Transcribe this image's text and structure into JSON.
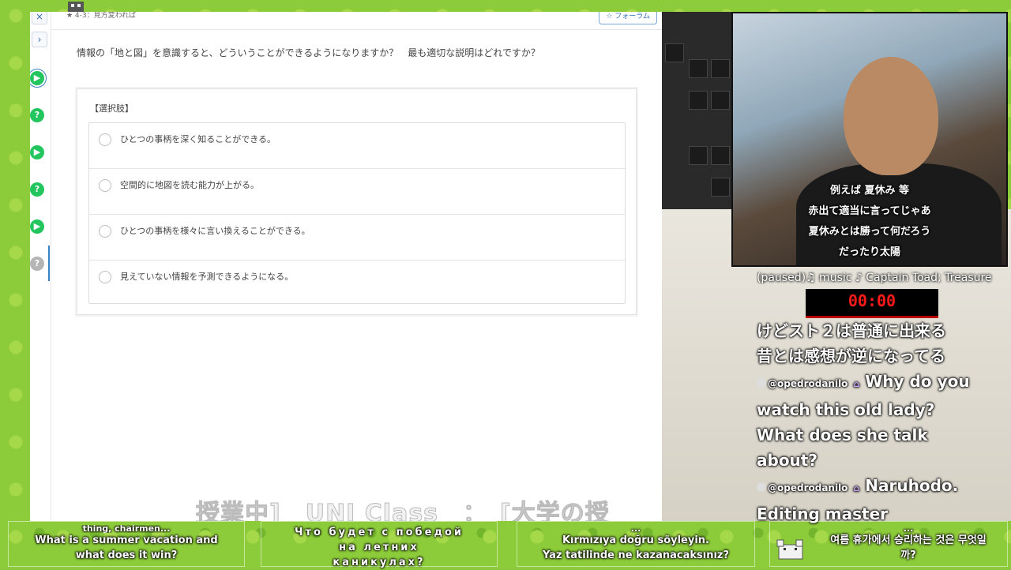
{
  "quiz": {
    "breadcrumb": "★ 4-3：見方変われば",
    "forum_label": "フォーラム",
    "question": "情報の「地と図」を意識すると、どういうことができるようになりますか？　最も適切な説明はどれですか？",
    "choices_heading": "【選択肢】",
    "choices": [
      "ひとつの事柄を深く知ることができる。",
      "空間的に地図を読む能力が上がる。",
      "ひとつの事柄を様々に言い換えることができる。",
      "見えていない情報を予測できるようになる。"
    ],
    "sidebar": {
      "close_icon": "×",
      "expand_icon": "›",
      "dot_play": "▶",
      "dot_question": "?"
    }
  },
  "banner_caption": "授業中]　UNI Class　：　[大学の授",
  "webcam": {
    "subtitles": [
      "例えば 夏休み 等",
      "赤出て適当に言ってじゃあ",
      "夏休みとは勝って何だろう",
      "だったり太陽"
    ]
  },
  "music_line": "(paused)♫ music ♪ Captain Toad; Treasure",
  "timer": "00:00",
  "chat": {
    "lines_top": [
      "けどスト２は普通に出来る",
      "昔とは感想が逆になってる"
    ],
    "messages": [
      {
        "user": "@opedrodanilo",
        "text_lines": [
          "Why do you",
          "watch this old lady?",
          "What does she talk",
          "about?"
        ]
      },
      {
        "user": "@opedrodanilo",
        "text_lines": [
          "Naruhodo.",
          "Editing master"
        ]
      }
    ],
    "badge_icon": "⌂"
  },
  "bottom_subtitles": {
    "en": [
      "thing, chairmen...",
      "What is a summer vacation and",
      "what does it win?"
    ],
    "ru": [
      "Что будет с победой",
      "на летних",
      "каникулах?"
    ],
    "tr": [
      "...",
      "Kırmızıya doğru söyleyin.",
      "Yaz tatilinde ne kazanacaksınız?"
    ],
    "ko": [
      "...",
      "여름 휴가에서 승리하는 것은 무엇일",
      "까?"
    ]
  },
  "colors": {
    "accent": "#3b82c4",
    "play_green": "#22c55e",
    "question_green": "#22c55e",
    "inactive_grey": "#b5b5b5",
    "timer_red": "#ff1a1a"
  }
}
